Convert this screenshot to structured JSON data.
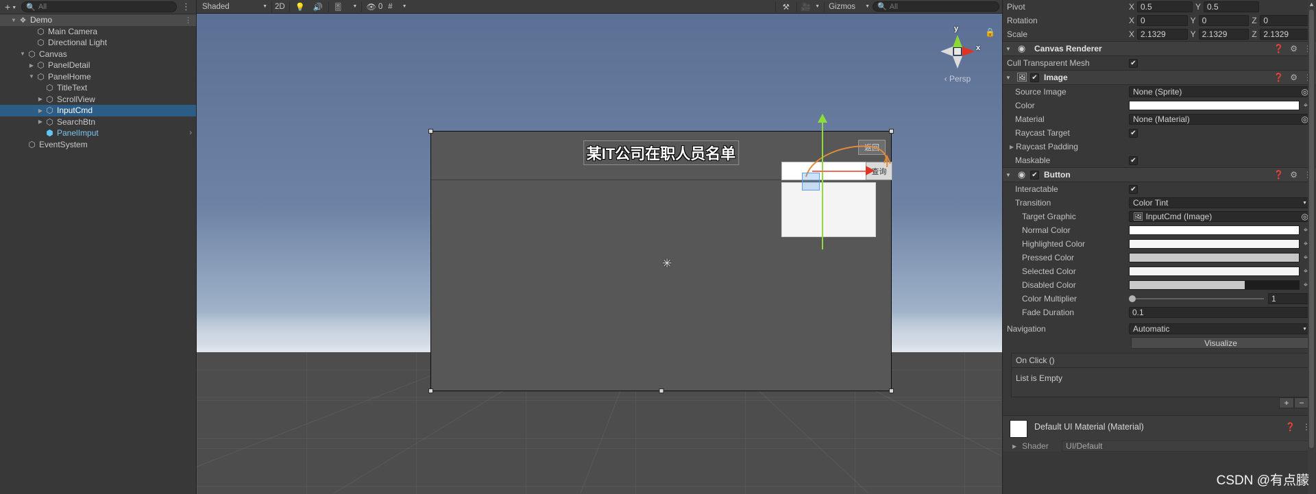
{
  "hierarchy": {
    "add_button": "+",
    "search_placeholder": "All",
    "rows": [
      {
        "label": "Demo",
        "depth": 0,
        "tri": "open",
        "icon": "scene-ico",
        "kind": "scene"
      },
      {
        "label": "Main Camera",
        "depth": 2,
        "tri": "none",
        "icon": "cube",
        "kind": "normal"
      },
      {
        "label": "Directional Light",
        "depth": 2,
        "tri": "none",
        "icon": "cube",
        "kind": "normal"
      },
      {
        "label": "Canvas",
        "depth": 1,
        "tri": "open",
        "icon": "cube",
        "kind": "normal"
      },
      {
        "label": "PanelDetail",
        "depth": 2,
        "tri": "closed",
        "icon": "cube",
        "kind": "normal"
      },
      {
        "label": "PanelHome",
        "depth": 2,
        "tri": "open",
        "icon": "cube",
        "kind": "normal"
      },
      {
        "label": "TitleText",
        "depth": 3,
        "tri": "none",
        "icon": "cube",
        "kind": "normal"
      },
      {
        "label": "ScrollView",
        "depth": 3,
        "tri": "closed",
        "icon": "cube",
        "kind": "normal"
      },
      {
        "label": "InputCmd",
        "depth": 3,
        "tri": "closed",
        "icon": "cube",
        "kind": "selected"
      },
      {
        "label": "SearchBtn",
        "depth": 3,
        "tri": "closed",
        "icon": "cube",
        "kind": "normal"
      },
      {
        "label": "PanelImput",
        "depth": 3,
        "tri": "none",
        "icon": "prefab",
        "kind": "prefab"
      },
      {
        "label": "EventSystem",
        "depth": 1,
        "tri": "none",
        "icon": "cube",
        "kind": "normal"
      }
    ]
  },
  "scene_toolbar": {
    "shading_mode": "Shaded",
    "mode_2d": "2D",
    "lighting_icon": "light-bulb-icon",
    "audio_icon": "speaker-icon",
    "fx_icon": "effects-icon",
    "hidden_objects_count": "0",
    "grid_icon": "grid-icon",
    "tools_icon": "tools-icon",
    "camera_icon": "camera-icon",
    "gizmos_label": "Gizmos",
    "search_placeholder": "All"
  },
  "scene": {
    "axis_gizmo": {
      "y_label": "y",
      "x_label": "x",
      "mode": "Persp",
      "lock_icon": "lock-icon"
    },
    "game_ui": {
      "title": "某IT公司在职人员名单",
      "return_button": "返回",
      "query_button": "查询"
    }
  },
  "inspector": {
    "transform": {
      "pivot": {
        "label": "Pivot",
        "x_axis": "X",
        "x": "0.5",
        "y_axis": "Y",
        "y": "0.5"
      },
      "rotation": {
        "label": "Rotation",
        "x_axis": "X",
        "x": "0",
        "y_axis": "Y",
        "y": "0",
        "z_axis": "Z",
        "z": "0"
      },
      "scale": {
        "label": "Scale",
        "x_axis": "X",
        "x": "2.1329",
        "y_axis": "Y",
        "y": "2.1329",
        "z_axis": "Z",
        "z": "2.1329"
      }
    },
    "canvas_renderer": {
      "title": "Canvas Renderer",
      "icon": "eye-icon",
      "cull_transparent_mesh": {
        "label": "Cull Transparent Mesh",
        "checked": "✔"
      }
    },
    "image": {
      "title": "Image",
      "icon": "image-icon",
      "enabled": "✔",
      "source_image": {
        "label": "Source Image",
        "value": "None (Sprite)"
      },
      "color": {
        "label": "Color",
        "hex": "#ffffff"
      },
      "material": {
        "label": "Material",
        "value": "None (Material)"
      },
      "raycast_target": {
        "label": "Raycast Target",
        "checked": "✔"
      },
      "raycast_padding": {
        "label": "Raycast Padding"
      },
      "maskable": {
        "label": "Maskable",
        "checked": "✔"
      }
    },
    "button": {
      "title": "Button",
      "icon": "button-icon",
      "enabled": "✔",
      "interactable": {
        "label": "Interactable",
        "checked": "✔"
      },
      "transition": {
        "label": "Transition",
        "value": "Color Tint"
      },
      "target_graphic": {
        "label": "Target Graphic",
        "value": "InputCmd (Image)"
      },
      "normal_color": {
        "label": "Normal Color",
        "hex": "#ffffff"
      },
      "highlighted_color": {
        "label": "Highlighted Color",
        "hex": "#f5f5f5"
      },
      "pressed_color": {
        "label": "Pressed Color",
        "hex": "#c8c8c8"
      },
      "selected_color": {
        "label": "Selected Color",
        "hex": "#f5f5f5"
      },
      "disabled_color": {
        "label": "Disabled Color",
        "hex": "#c8c8c8"
      },
      "color_multiplier": {
        "label": "Color Multiplier",
        "value": "1"
      },
      "fade_duration": {
        "label": "Fade Duration",
        "value": "0.1"
      },
      "navigation": {
        "label": "Navigation",
        "value": "Automatic"
      },
      "visualize_button": "Visualize",
      "on_click": {
        "header": "On Click ()",
        "empty_text": "List is Empty",
        "add": "+",
        "remove": "−"
      }
    },
    "material_preview": {
      "title": "Default UI Material (Material)",
      "shader_label": "Shader",
      "shader_value": "UI/Default"
    }
  },
  "watermark": "CSDN @有点朦"
}
